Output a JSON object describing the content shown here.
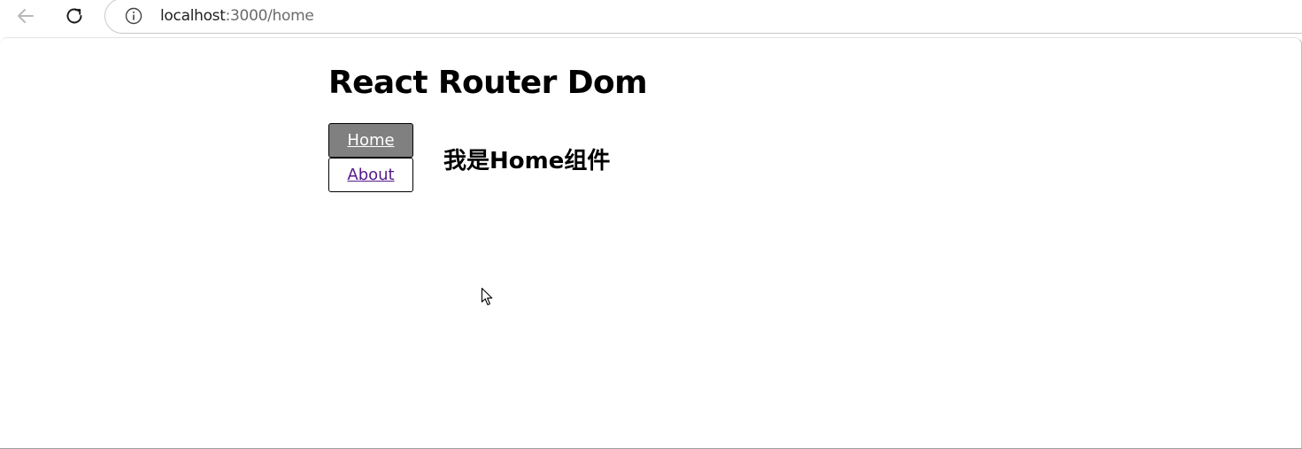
{
  "browser": {
    "url_host": "localhost",
    "url_rest": ":3000/home",
    "icons": {
      "back": "arrow-left-icon",
      "reload": "reload-icon",
      "site_info": "info-icon"
    }
  },
  "page": {
    "title": "React Router Dom",
    "nav": [
      {
        "label": "Home",
        "active": true
      },
      {
        "label": "About",
        "active": false
      }
    ],
    "content_heading": "我是Home组件"
  },
  "colors": {
    "active_bg": "#808080",
    "active_text": "#ffffff",
    "visited_link": "#551a8b"
  }
}
